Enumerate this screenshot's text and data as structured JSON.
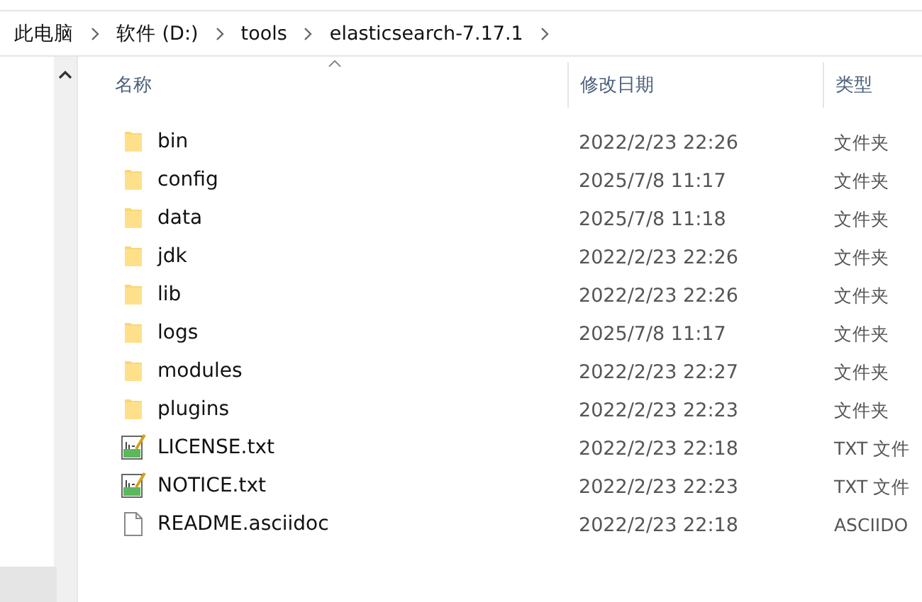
{
  "breadcrumb": [
    "此电脑",
    "软件 (D:)",
    "tools",
    "elasticsearch-7.17.1"
  ],
  "columns": [
    {
      "label": "名称",
      "sorted": true
    },
    {
      "label": "修改日期",
      "sorted": false
    },
    {
      "label": "类型",
      "sorted": false
    }
  ],
  "rows": [
    {
      "kind": "folder",
      "name": "bin",
      "date": "2022/2/23 22:26",
      "type": "文件夹"
    },
    {
      "kind": "folder",
      "name": "config",
      "date": "2025/7/8 11:17",
      "type": "文件夹"
    },
    {
      "kind": "folder",
      "name": "data",
      "date": "2025/7/8 11:18",
      "type": "文件夹"
    },
    {
      "kind": "folder",
      "name": "jdk",
      "date": "2022/2/23 22:26",
      "type": "文件夹"
    },
    {
      "kind": "folder",
      "name": "lib",
      "date": "2022/2/23 22:26",
      "type": "文件夹"
    },
    {
      "kind": "folder",
      "name": "logs",
      "date": "2025/7/8 11:17",
      "type": "文件夹"
    },
    {
      "kind": "folder",
      "name": "modules",
      "date": "2022/2/23 22:27",
      "type": "文件夹"
    },
    {
      "kind": "folder",
      "name": "plugins",
      "date": "2022/2/23 22:23",
      "type": "文件夹"
    },
    {
      "kind": "text",
      "name": "LICENSE.txt",
      "date": "2022/2/23 22:18",
      "type": "TXT 文件"
    },
    {
      "kind": "text",
      "name": "NOTICE.txt",
      "date": "2022/2/23 22:23",
      "type": "TXT 文件"
    },
    {
      "kind": "file",
      "name": "README.asciidoc",
      "date": "2022/2/23 22:18",
      "type": "ASCIIDO"
    }
  ]
}
